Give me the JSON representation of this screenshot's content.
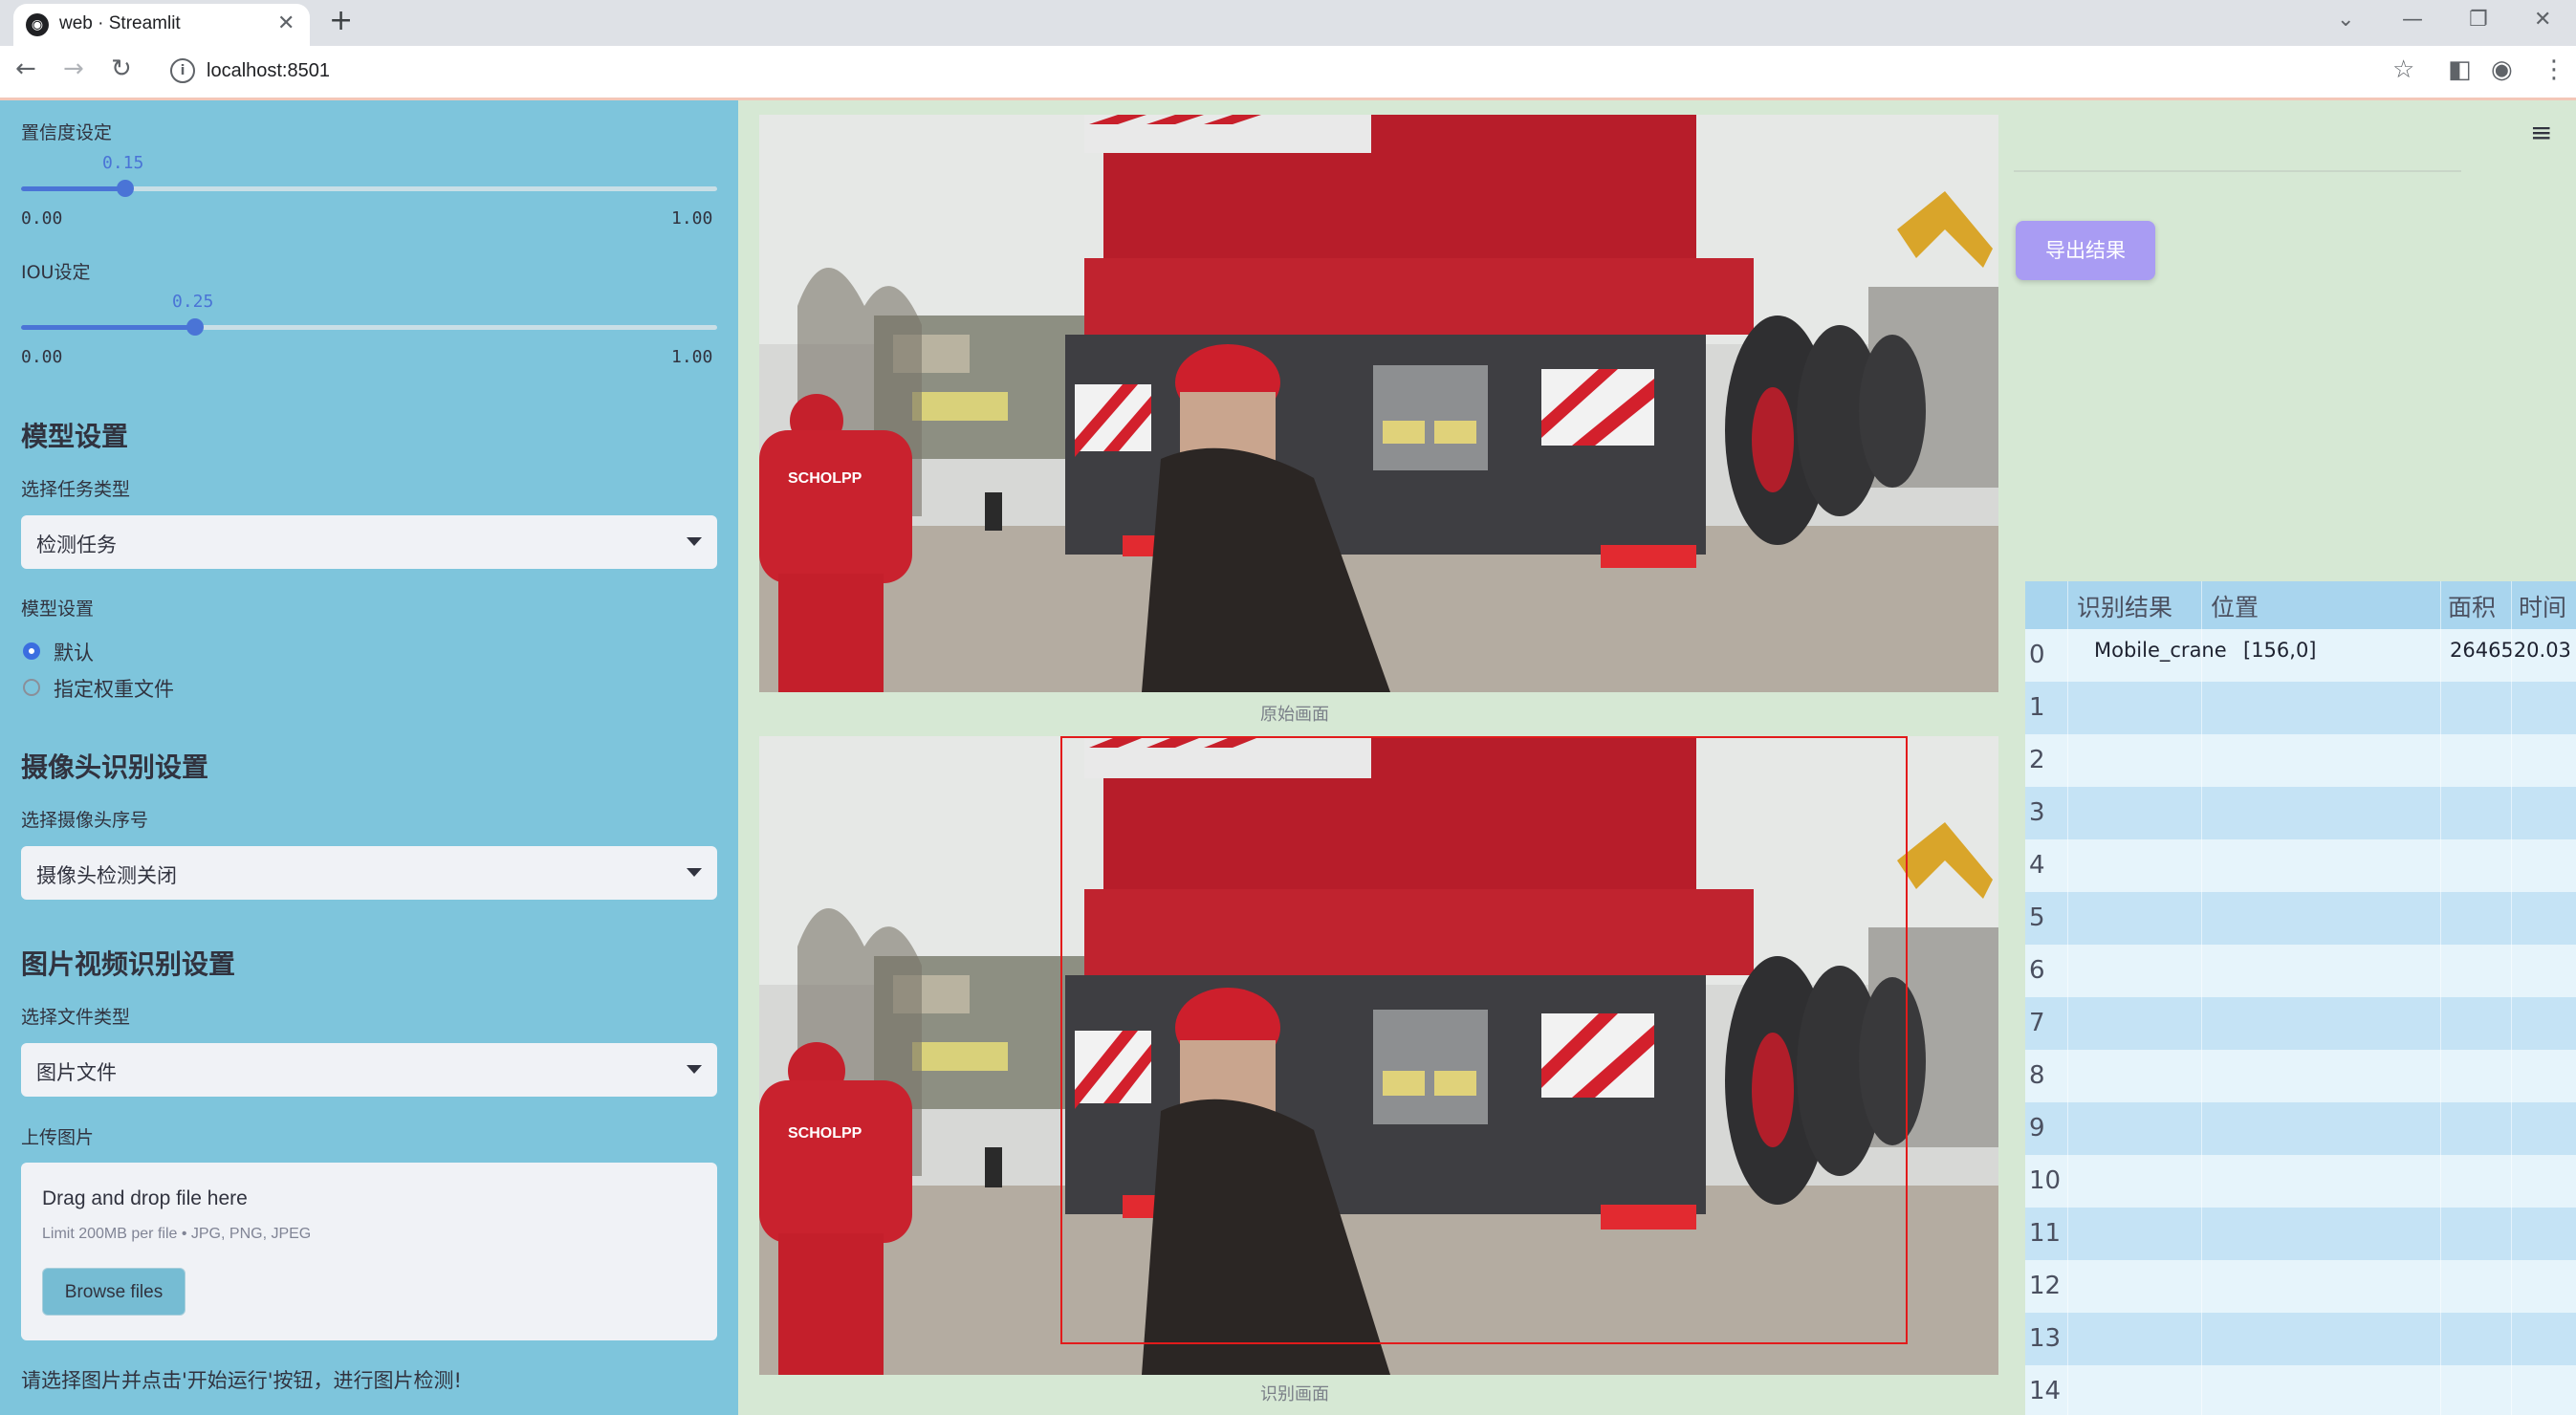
{
  "browser": {
    "tab_title": "web · Streamlit",
    "url": "localhost:8501",
    "new_tab": "+",
    "close_tab": "✕"
  },
  "sidebar": {
    "confidence": {
      "label": "置信度设定",
      "value": "0.15",
      "value_fraction": 0.15,
      "min": "0.00",
      "max": "1.00"
    },
    "iou": {
      "label": "IOU设定",
      "value": "0.25",
      "value_fraction": 0.25,
      "min": "0.00",
      "max": "1.00"
    },
    "model_section_title": "模型设置",
    "task_type_label": "选择任务类型",
    "task_type_value": "检测任务",
    "model_label": "模型设置",
    "model_options": [
      "默认",
      "指定权重文件"
    ],
    "model_selected": "默认",
    "camera_section_title": "摄像头识别设置",
    "camera_label": "选择摄像头序号",
    "camera_value": "摄像头检测关闭",
    "media_section_title": "图片视频识别设置",
    "file_type_label": "选择文件类型",
    "file_type_value": "图片文件",
    "upload_label": "上传图片",
    "uploader": {
      "title": "Drag and drop file here",
      "limit": "Limit 200MB per file • JPG, PNG, JPEG",
      "button": "Browse files"
    },
    "hint": "请选择图片并点击'开始运行'按钮，进行图片检测!"
  },
  "main": {
    "original_caption": "原始画面",
    "result_caption": "识别画面",
    "export_button": "导出结果"
  },
  "table": {
    "columns": [
      "识别结果",
      "位置",
      "面积",
      "时间"
    ],
    "rows": [
      {
        "index": "0",
        "result": "Mobile_crane",
        "position": "[156,0]",
        "area": "2646520.03",
        "time": ""
      },
      {
        "index": "1"
      },
      {
        "index": "2"
      },
      {
        "index": "3"
      },
      {
        "index": "4"
      },
      {
        "index": "5"
      },
      {
        "index": "6"
      },
      {
        "index": "7"
      },
      {
        "index": "8"
      },
      {
        "index": "9"
      },
      {
        "index": "10"
      },
      {
        "index": "11"
      },
      {
        "index": "12"
      },
      {
        "index": "13"
      },
      {
        "index": "14"
      }
    ]
  },
  "colors": {
    "sidebar_bg": "#7ec5dc",
    "main_bg": "#d6e8d4",
    "slider_accent": "#4a74d6",
    "export_button": "#a99cf3",
    "detection_box": "#e21b1b",
    "table_header": "#a9d5ee"
  }
}
